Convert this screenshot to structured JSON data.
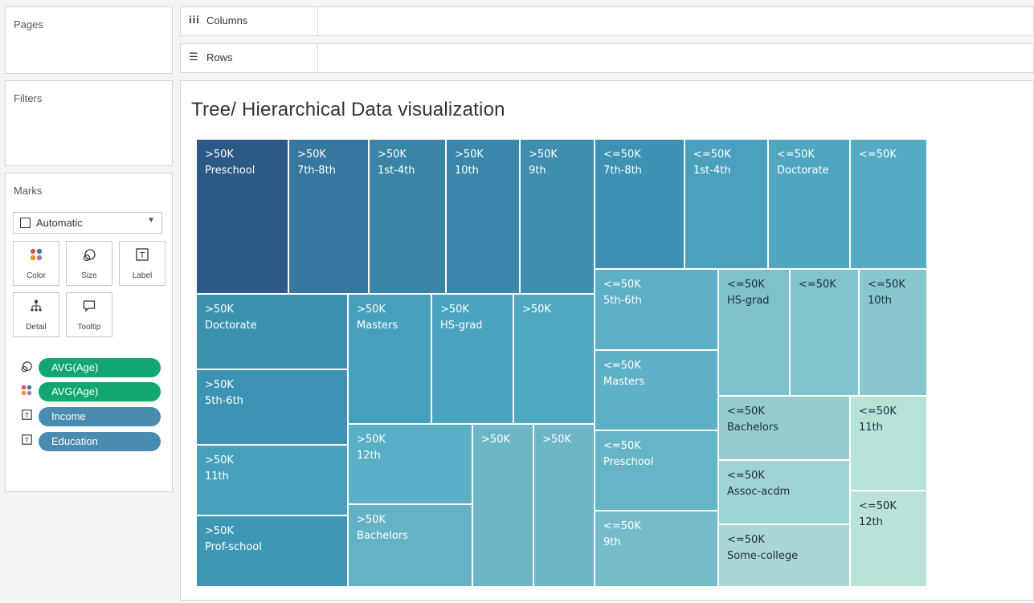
{
  "pages_label": "Pages",
  "filters_label": "Filters",
  "columns_label": "Columns",
  "rows_label": "Rows",
  "marks": {
    "label": "Marks",
    "mark_type": "Automatic",
    "cards": [
      {
        "label": "Color",
        "icon": "color-dots-icon"
      },
      {
        "label": "Size",
        "icon": "size-icon"
      },
      {
        "label": "Label",
        "icon": "label-icon"
      },
      {
        "label": "Detail",
        "icon": "detail-icon"
      },
      {
        "label": "Tooltip",
        "icon": "tooltip-icon"
      }
    ],
    "pills": [
      {
        "icon": "size-icon",
        "text": "AVG(Age)",
        "color": "#12a671"
      },
      {
        "icon": "color-dots-icon",
        "text": "AVG(Age)",
        "color": "#12a671"
      },
      {
        "icon": "label-icon",
        "text": "Income",
        "color": "#4a8bb1"
      },
      {
        "icon": "label-icon",
        "text": "Education",
        "color": "#4a8bb1"
      }
    ]
  },
  "view_title": "Tree/ Hierarchical Data visualization",
  "treemap": {
    "cells": [
      {
        "income": ">50K",
        "education": "Preschool",
        "color": "#2c5986"
      },
      {
        "income": ">50K",
        "education": "7th-8th",
        "color": "#36789f"
      },
      {
        "income": ">50K",
        "education": "1st-4th",
        "color": "#3a84a8"
      },
      {
        "income": ">50K",
        "education": "10th",
        "color": "#3b87ab"
      },
      {
        "income": ">50K",
        "education": "9th",
        "color": "#3e8eb0"
      },
      {
        "income": ">50K",
        "education": "Doctorate",
        "color": "#3c91b1"
      },
      {
        "income": ">50K",
        "education": "5th-6th",
        "color": "#3d93b3"
      },
      {
        "income": ">50K",
        "education": "11th",
        "color": "#45a1be"
      },
      {
        "income": ">50K",
        "education": "Prof-school",
        "color": "#3e98b5"
      },
      {
        "income": ">50K",
        "education": "Masters",
        "color": "#46a0bd"
      },
      {
        "income": ">50K",
        "education": "HS-grad",
        "color": "#4aa3bf"
      },
      {
        "income": ">50K",
        "education": "",
        "color": "#4fa8c2"
      },
      {
        "income": ">50K",
        "education": "12th",
        "color": "#58afc6"
      },
      {
        "income": ">50K",
        "education": "Bachelors",
        "color": "#64b2c5"
      },
      {
        "income": ">50K",
        "education": "",
        "color": "#6cb6c7"
      },
      {
        "income": ">50K",
        "education": "",
        "color": "#6db6c6"
      },
      {
        "income": "<=50K",
        "education": "7th-8th",
        "color": "#3e91b3"
      },
      {
        "income": "<=50K",
        "education": "1st-4th",
        "color": "#4aa0bd"
      },
      {
        "income": "<=50K",
        "education": "Doctorate",
        "color": "#4ea6c0"
      },
      {
        "income": "<=50K",
        "education": "",
        "color": "#55aac4"
      },
      {
        "income": "<=50K",
        "education": "5th-6th",
        "color": "#5dafc5"
      },
      {
        "income": "<=50K",
        "education": "Masters",
        "color": "#5eb0c6"
      },
      {
        "income": "<=50K",
        "education": "Preschool",
        "color": "#66b5c6"
      },
      {
        "income": "<=50K",
        "education": "9th",
        "color": "#75bcca"
      },
      {
        "income": "<=50K",
        "education": "HS-grad",
        "color": "#7fc1ca"
      },
      {
        "income": "<=50K",
        "education": "",
        "color": "#80c3cb"
      },
      {
        "income": "<=50K",
        "education": "10th",
        "color": "#87c6cd"
      },
      {
        "income": "<=50K",
        "education": "Bachelors",
        "color": "#95ccd0"
      },
      {
        "income": "<=50K",
        "education": "11th",
        "color": "#b7e2d9"
      },
      {
        "income": "<=50K",
        "education": "Assoc-acdm",
        "color": "#a0d3d3"
      },
      {
        "income": "<=50K",
        "education": "12th",
        "color": "#b9e3d9"
      },
      {
        "income": "<=50K",
        "education": "Some-college",
        "color": "#a8d7d4"
      }
    ]
  }
}
